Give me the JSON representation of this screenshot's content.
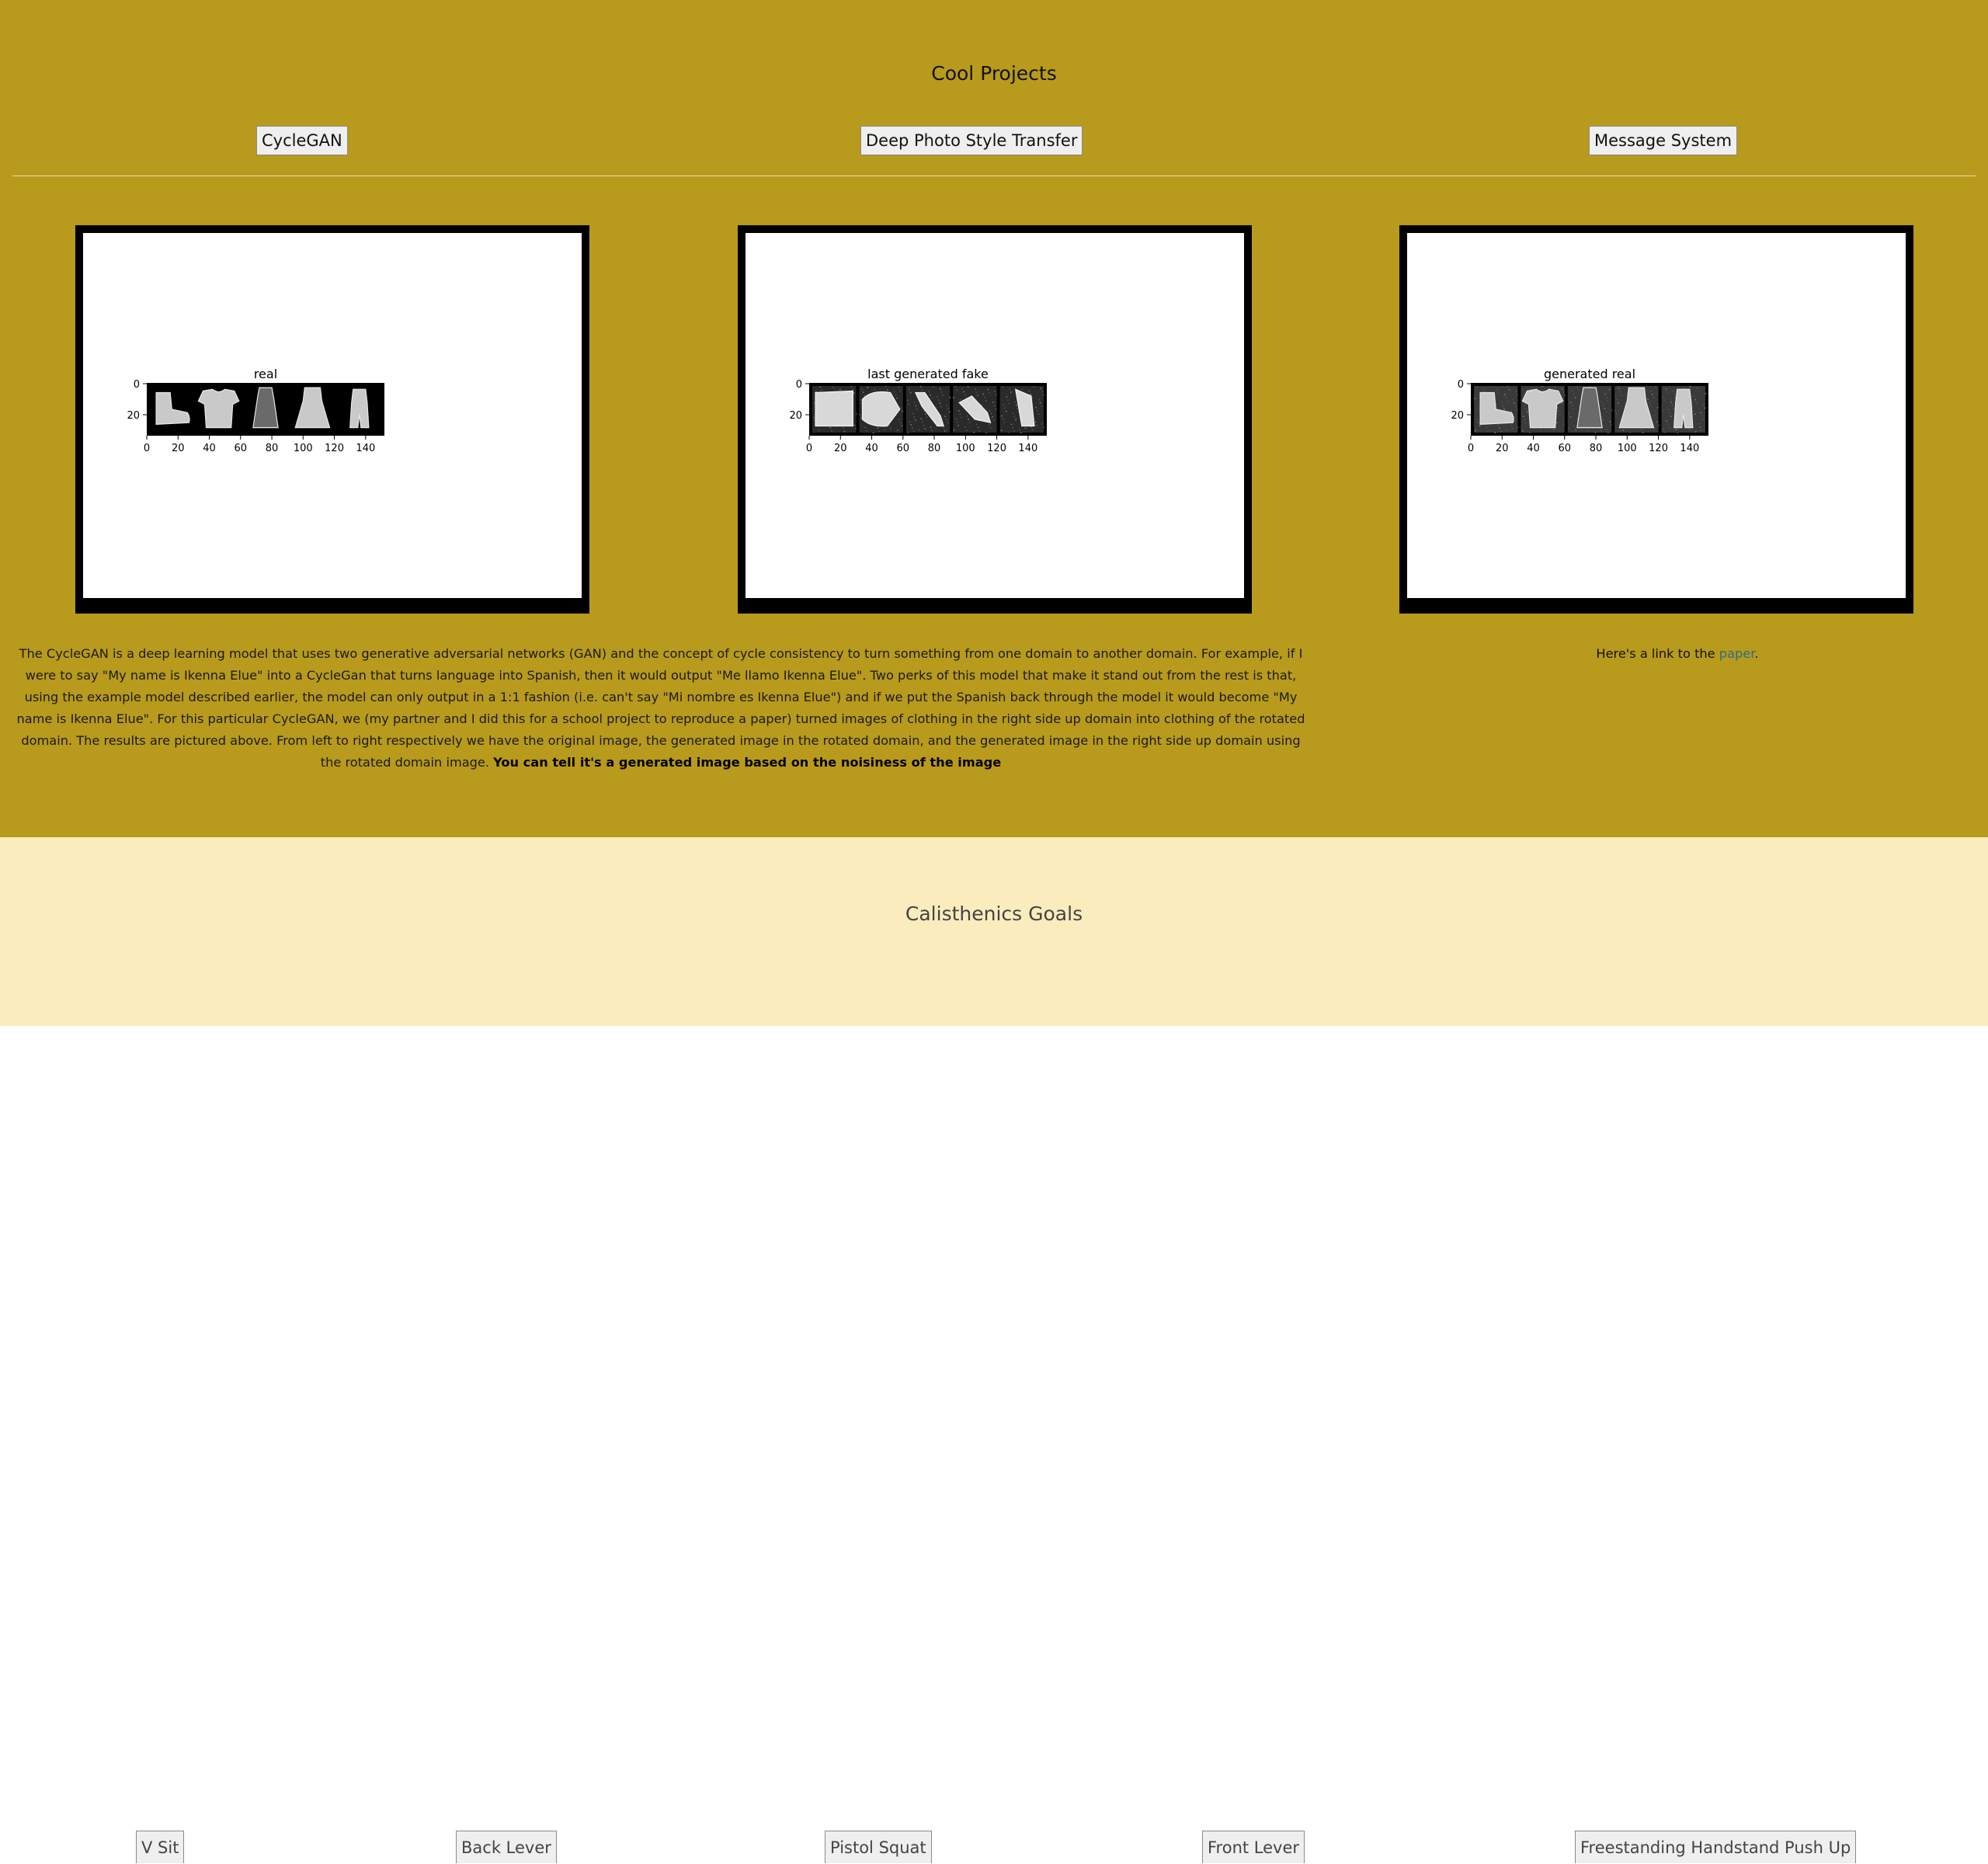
{
  "projects": {
    "title": "Cool Projects",
    "tabs": [
      {
        "label": "CycleGAN"
      },
      {
        "label": "Deep Photo Style Transfer"
      },
      {
        "label": "Message System"
      }
    ],
    "figures": [
      {
        "title": "real",
        "style": "clean"
      },
      {
        "title": "last generated fake",
        "style": "fake"
      },
      {
        "title": "generated real",
        "style": "noisy"
      }
    ],
    "axes": {
      "x_ticks": [
        "0",
        "20",
        "40",
        "60",
        "80",
        "100",
        "120",
        "140"
      ],
      "y_ticks": [
        "0",
        "20"
      ]
    },
    "description": {
      "text": "The CycleGAN is a deep learning model that uses two generative adversarial networks (GAN) and the concept of cycle consistency to turn something from one domain to another domain. For example, if I were to say \"My name is Ikenna Elue\" into a CycleGan that turns language into Spanish, then it would output \"Me llamo Ikenna Elue\". Two perks of this model that make it stand out from the rest is that, using the example model described earlier, the model can only output in a 1:1 fashion (i.e. can't say \"Mi nombre es Ikenna Elue\") and if we put the Spanish back through the model it would become \"My name is Ikenna Elue\". For this particular CycleGAN, we (my partner and I did this for a school project to reproduce a paper) turned images of clothing in the right side up domain into clothing of the rotated domain. The results are pictured above. From left to right respectively we have the original image, the generated image in the rotated domain, and the generated image in the right side up domain using the rotated domain image.",
      "emphasis": "You can tell it's a generated image based on the noisiness of the image"
    },
    "link_prefix": "Here's a link to the ",
    "link_text": "paper",
    "link_suffix": "."
  },
  "calisthenics": {
    "title": "Calisthenics Goals",
    "goals": [
      {
        "label": "V Sit"
      },
      {
        "label": "Back Lever"
      },
      {
        "label": "Pistol Squat"
      },
      {
        "label": "Front Lever"
      },
      {
        "label": "Freestanding Handstand Push Up"
      }
    ]
  },
  "colors": {
    "projects_bg": "#b89a1c",
    "goals_bg": "#faecbd",
    "link": "#2c6e87"
  }
}
